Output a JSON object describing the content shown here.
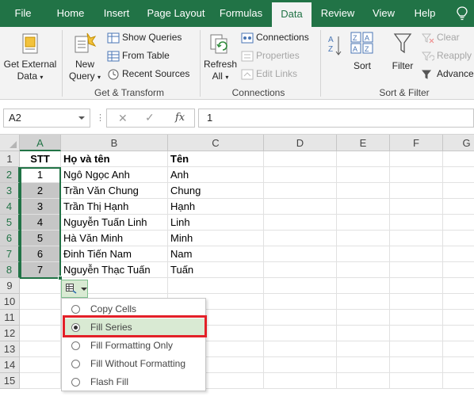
{
  "tabs": [
    "File",
    "Home",
    "Insert",
    "Page Layout",
    "Formulas",
    "Data",
    "Review",
    "View",
    "Help"
  ],
  "active_tab": "Data",
  "ribbon": {
    "get_transform": {
      "get_external_data": "Get External Data",
      "get_external_data_l1": "Get External",
      "get_external_data_l2": "Data",
      "new_query_l1": "New",
      "new_query_l2": "Query",
      "show_queries": "Show Queries",
      "from_table": "From Table",
      "recent_sources": "Recent Sources",
      "label": "Get & Transform"
    },
    "connections": {
      "refresh_l1": "Refresh",
      "refresh_l2": "All",
      "connections": "Connections",
      "properties": "Properties",
      "edit_links": "Edit Links",
      "label": "Connections"
    },
    "sort_filter": {
      "sort": "Sort",
      "filter": "Filter",
      "clear": "Clear",
      "reapply": "Reapply",
      "advanced": "Advanced",
      "label": "Sort & Filter"
    }
  },
  "formula_bar": {
    "name_box": "A2",
    "formula": "1"
  },
  "columns": [
    "A",
    "B",
    "C",
    "D",
    "E",
    "F",
    "G"
  ],
  "rows": [
    "1",
    "2",
    "3",
    "4",
    "5",
    "6",
    "7",
    "8",
    "9",
    "10",
    "11",
    "12",
    "13",
    "14",
    "15"
  ],
  "sheet": {
    "headers": [
      "STT",
      "Họ và tên",
      "Tên"
    ],
    "data": [
      [
        "1",
        "Ngô Ngọc Anh",
        "Anh"
      ],
      [
        "2",
        "Trần Văn Chung",
        "Chung"
      ],
      [
        "3",
        "Trần Thị Hạnh",
        "Hạnh"
      ],
      [
        "4",
        "Nguyễn Tuấn Linh",
        "Linh"
      ],
      [
        "5",
        "Hà Văn Minh",
        "Minh"
      ],
      [
        "6",
        "Đinh Tiến Nam",
        "Nam"
      ],
      [
        "7",
        "Nguyễn Thạc Tuấn",
        "Tuấn"
      ]
    ]
  },
  "autofill_menu": {
    "items": [
      "Copy Cells",
      "Fill Series",
      "Fill Formatting Only",
      "Fill Without Formatting",
      "Flash Fill"
    ],
    "selected": "Fill Series"
  },
  "colors": {
    "excel_green": "#217346",
    "highlight": "#e32028"
  }
}
